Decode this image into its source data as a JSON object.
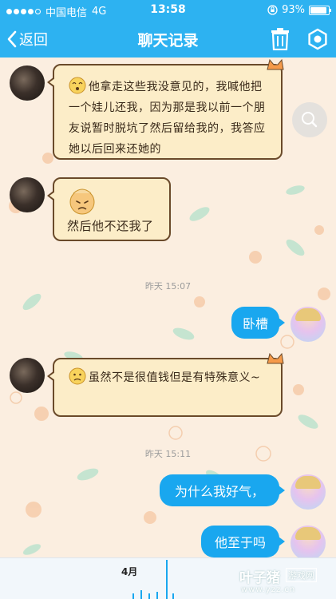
{
  "status_bar": {
    "carrier": "中国电信",
    "network": "4G",
    "time": "13:58",
    "battery": "93%",
    "battery_level": 0.93
  },
  "nav": {
    "back_label": "返回",
    "title": "聊天记录",
    "trash_icon": "trash-icon",
    "settings_icon": "settings-icon"
  },
  "messages": [
    {
      "sender": "other",
      "text": "他拿走这些我没意见的，我喊他把一个娃儿还我，因为那是我以前一个朋友说暂时脱坑了然后留给我的，我答应她以后回来还她的"
    },
    {
      "sender": "other",
      "text": "然后他不还我了"
    },
    {
      "type": "time",
      "text": "昨天 15:07"
    },
    {
      "sender": "me",
      "text": "卧槽"
    },
    {
      "sender": "other",
      "text": "虽然不是很值钱但是有特殊意义~"
    },
    {
      "type": "time",
      "text": "昨天 15:11"
    },
    {
      "sender": "me",
      "text": "为什么我好气，"
    },
    {
      "sender": "me",
      "text": "他至于吗"
    }
  ],
  "timeline": {
    "month": "4月"
  },
  "watermark": {
    "title": "叶子猪",
    "box": "游戏网",
    "url": "www.yzz.cn"
  },
  "colors": {
    "accent": "#2db2f1",
    "bubble_blue": "#19a7ef",
    "note_bg": "#fcedc8",
    "chat_bg": "#fbeee0"
  }
}
